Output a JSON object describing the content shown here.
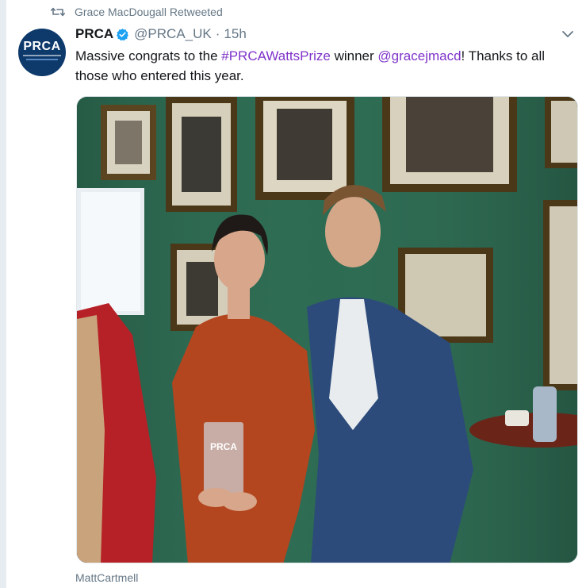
{
  "retweet": {
    "icon": "retweet-icon",
    "text": "Grace MacDougall Retweeted"
  },
  "author": {
    "avatar_text": "PRCA",
    "name": "PRCA",
    "verified_icon": "verified-badge-icon",
    "handle": "@PRCA_UK",
    "separator": "·",
    "time": "15h"
  },
  "tweet": {
    "text_before_hashtag": "Massive congrats to the ",
    "hashtag": "#PRCAWattsPrize",
    "text_middle": " winner ",
    "mention": "@gracejmacd",
    "text_after": "! Thanks to all those who entered this year.",
    "link_color": "#7e33c9"
  },
  "media": {
    "trophy_text": "PRCA",
    "caption": "MattCartmell"
  },
  "colors": {
    "secondary_text": "#657786",
    "verified_blue": "#1da1f2",
    "rail": "#e6ecf0"
  }
}
